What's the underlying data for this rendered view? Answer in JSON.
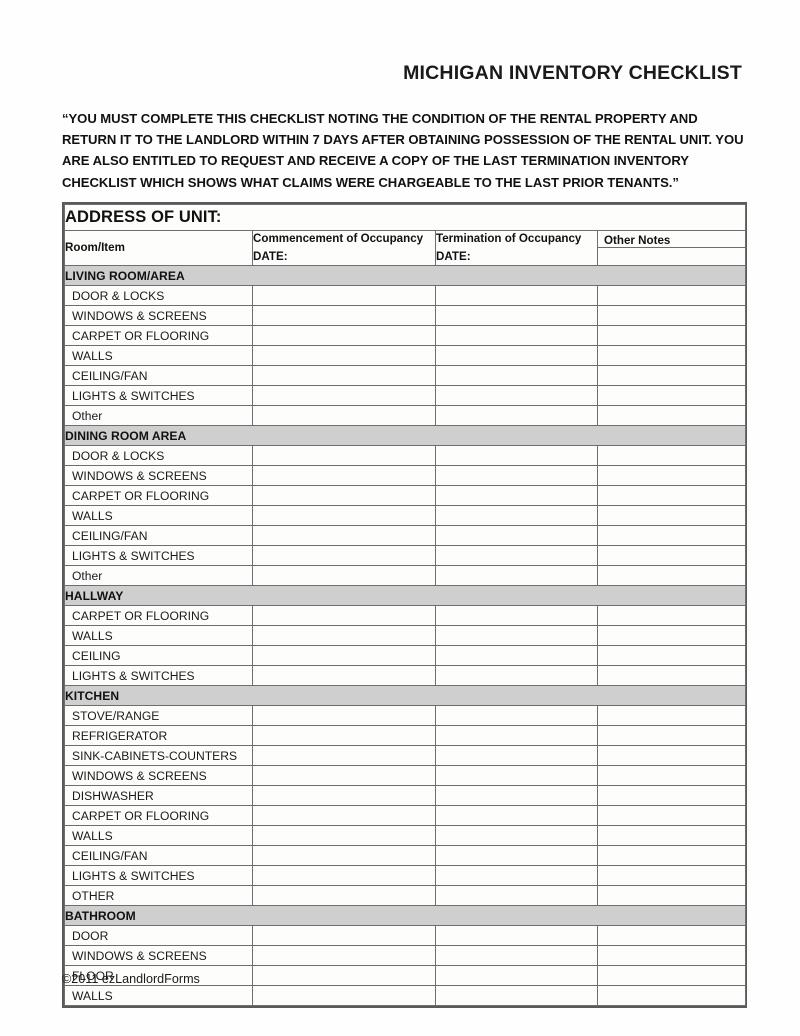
{
  "document": {
    "title": "MICHIGAN INVENTORY CHECKLIST",
    "intro": "“YOU MUST COMPLETE THIS CHECKLIST NOTING THE CONDITION OF THE RENTAL PROPERTY AND RETURN IT TO THE LANDLORD WITHIN 7 DAYS AFTER OBTAINING POSSESSION OF THE RENTAL UNIT. YOU ARE ALSO ENTITLED TO REQUEST AND RECEIVE A COPY OF THE LAST TERMINATION INVENTORY CHECKLIST WHICH SHOWS WHAT CLAIMS WERE CHARGEABLE TO THE LAST PRIOR TENANTS.”",
    "footer": "©2011 ezLandlordForms"
  },
  "table": {
    "address_row_label": "ADDRESS OF UNIT:",
    "address_value": "",
    "columns": {
      "item": "Room/Item",
      "commencement": "Commencement of Occupancy",
      "commencement_date": "DATE:",
      "termination": "Termination of Occupancy",
      "termination_date": "DATE:",
      "notes": "Other Notes"
    },
    "sections": [
      {
        "name": "LIVING ROOM/AREA",
        "items": [
          "DOOR & LOCKS",
          "WINDOWS & SCREENS",
          "CARPET OR FLOORING",
          "WALLS",
          "CEILING/FAN",
          "LIGHTS & SWITCHES",
          "Other"
        ]
      },
      {
        "name": "DINING ROOM AREA",
        "items": [
          "DOOR & LOCKS",
          "WINDOWS & SCREENS",
          "CARPET OR FLOORING",
          "WALLS",
          "CEILING/FAN",
          "LIGHTS & SWITCHES",
          "Other"
        ]
      },
      {
        "name": "HALLWAY",
        "items": [
          "CARPET OR FLOORING",
          "WALLS",
          "CEILING",
          "LIGHTS & SWITCHES"
        ]
      },
      {
        "name": "KITCHEN",
        "items": [
          "STOVE/RANGE",
          "REFRIGERATOR",
          "SINK-CABINETS-COUNTERS",
          "WINDOWS & SCREENS",
          "DISHWASHER",
          "CARPET OR FLOORING",
          "WALLS",
          "CEILING/FAN",
          "LIGHTS & SWITCHES",
          "OTHER"
        ]
      },
      {
        "name": "BATHROOM",
        "items": [
          "DOOR",
          "WINDOWS & SCREENS",
          "FLOOR",
          "WALLS"
        ]
      }
    ]
  },
  "colors": {
    "section_header_bg": "#cfcfcf",
    "border": "#6e6e6e",
    "text": "#111111",
    "page_bg": "#fefefe"
  }
}
